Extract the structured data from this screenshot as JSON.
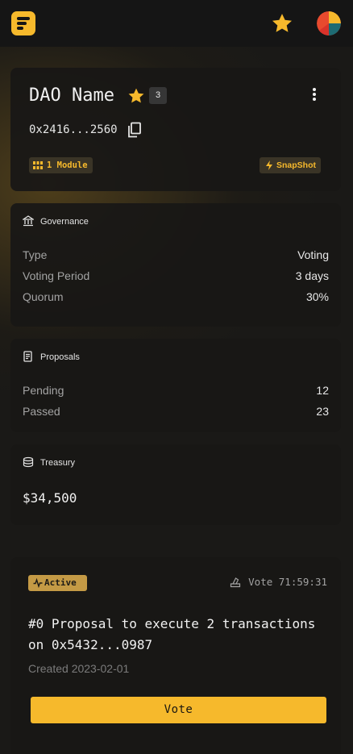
{
  "colors": {
    "accent": "#f6b92c",
    "background": "#1a1917",
    "card": "#181716",
    "muted_text": "#a3a3a3"
  },
  "header": {
    "logo_icon": "app-logo",
    "favorite_icon": "star-icon",
    "avatar_icon": "user-avatar"
  },
  "dao": {
    "name": "DAO Name",
    "star_icon": "star-icon",
    "badge_count": "3",
    "address": "0x2416...2560",
    "copy_icon": "copy-icon",
    "more_icon": "more-vertical-icon",
    "modules_label": "1 Module",
    "snapshot_label": "SnapShot"
  },
  "governance": {
    "title": "Governance",
    "rows": [
      {
        "label": "Type",
        "value": "Voting"
      },
      {
        "label": "Voting Period",
        "value": "3 days"
      },
      {
        "label": "Quorum",
        "value": "30%"
      }
    ]
  },
  "proposals": {
    "title": "Proposals",
    "rows": [
      {
        "label": "Pending",
        "value": "12"
      },
      {
        "label": "Passed",
        "value": "23"
      }
    ]
  },
  "treasury": {
    "title": "Treasury",
    "value": "$34,500"
  },
  "proposal_card": {
    "status": "Active",
    "vote_timer": "Vote 71:59:31",
    "title": "#0 Proposal to execute 2 transactions on 0x5432...0987",
    "created": "Created 2023-02-01",
    "vote_label": "Vote"
  }
}
